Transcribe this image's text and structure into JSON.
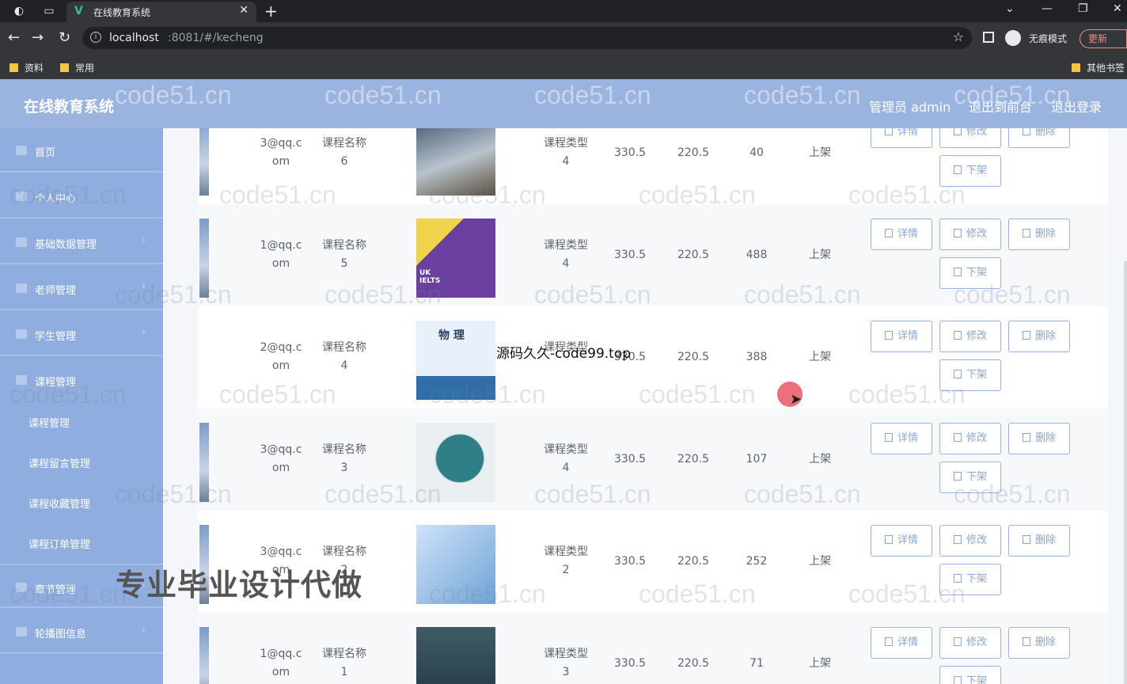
{
  "browser": {
    "tab_title": "在线教育系统",
    "tab_favicon": "V",
    "url_host": "localhost",
    "url_rest": ":8081/#/kecheng",
    "incognito_label": "无痕模式",
    "update_label": "更新",
    "bookmarks": [
      "资料",
      "常用"
    ],
    "other_bookmarks": "其他书签"
  },
  "header": {
    "title": "在线教育系统",
    "admin_label": "管理员 admin",
    "front_link": "退出到前台",
    "logout_link": "退出登录"
  },
  "sidebar": {
    "items": [
      {
        "label": "首页",
        "icon": "home-icon"
      },
      {
        "label": "个人中心",
        "icon": "user-icon"
      },
      {
        "label": "基础数据管理",
        "icon": "database-icon"
      },
      {
        "label": "老师管理",
        "icon": "teacher-icon"
      },
      {
        "label": "学生管理",
        "icon": "student-icon"
      },
      {
        "label": "课程管理",
        "icon": "course-icon"
      },
      {
        "label": "章节管理",
        "icon": "chapter-icon"
      },
      {
        "label": "轮播图信息",
        "icon": "carousel-icon"
      }
    ],
    "subitems": [
      "课程管理",
      "课程留言管理",
      "课程收藏管理",
      "课程订单管理"
    ]
  },
  "buttons": {
    "detail": "详情",
    "edit": "修改",
    "delete": "删除",
    "offshelf": "下架"
  },
  "rows": [
    {
      "email": "3@qq.c",
      "email2": "om",
      "name": "课程名称",
      "name_no": "6",
      "type": "课程类型",
      "type_no": "4",
      "price1": "330.5",
      "price2": "220.5",
      "count": "40",
      "status": "上架"
    },
    {
      "email": "1@qq.c",
      "email2": "om",
      "name": "课程名称",
      "name_no": "5",
      "type": "课程类型",
      "type_no": "4",
      "price1": "330.5",
      "price2": "220.5",
      "count": "488",
      "status": "上架"
    },
    {
      "email": "2@qq.c",
      "email2": "om",
      "name": "课程名称",
      "name_no": "4",
      "type": "课程类型",
      "type_no": "",
      "price1": "330.5",
      "price2": "220.5",
      "count": "388",
      "status": "上架"
    },
    {
      "email": "3@qq.c",
      "email2": "om",
      "name": "课程名称",
      "name_no": "3",
      "type": "课程类型",
      "type_no": "4",
      "price1": "330.5",
      "price2": "220.5",
      "count": "107",
      "status": "上架"
    },
    {
      "email": "3@qq.c",
      "email2": "om",
      "name": "课程名称",
      "name_no": "2",
      "type": "课程类型",
      "type_no": "2",
      "price1": "330.5",
      "price2": "220.5",
      "count": "252",
      "status": "上架"
    },
    {
      "email": "1@qq.c",
      "email2": "om",
      "name": "课程名称",
      "name_no": "1",
      "type": "课程类型",
      "type_no": "3",
      "price1": "330.5",
      "price2": "220.5",
      "count": "71",
      "status": "上架"
    }
  ],
  "image_text": {
    "ielts": "UK IELTS",
    "physics": "物 理"
  },
  "watermark": "code51.cn",
  "overlay_text": "源码久久-code99.top",
  "overlay_big": "专业毕业设计代做"
}
